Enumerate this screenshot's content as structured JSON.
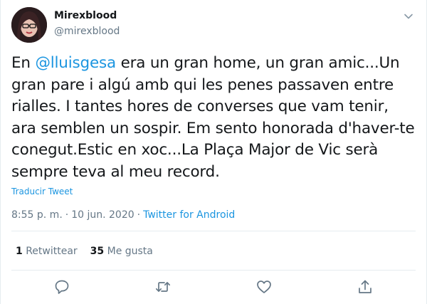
{
  "author": {
    "display_name": "Mirexblood",
    "handle": "@mirexblood"
  },
  "tweet": {
    "text_before_mention": "En ",
    "mention": "@lluisgesa",
    "text_after_mention": " era un gran home, un gran amic...Un gran pare i algú amb qui les penes passaven entre rialles. I tantes hores de converses que vam tenir, ara semblen un sospir. Em sento honorada d'haver-te conegut.Estic en xoc...La Plaça Major de Vic serà sempre teva al meu record."
  },
  "translate_label": "Traducir Tweet",
  "meta": {
    "time": "8:55 p. m.",
    "separator": "·",
    "date": "10 jun. 2020",
    "source": "Twitter for Android"
  },
  "stats": {
    "retweets_count": "1",
    "retweets_label": "Retwittear",
    "likes_count": "35",
    "likes_label": "Me gusta"
  },
  "icons": {
    "menu": "chevron-down-icon",
    "reply": "reply-icon",
    "retweet": "retweet-icon",
    "like": "heart-icon",
    "share": "share-icon"
  },
  "colors": {
    "link": "#1b95e0",
    "secondary_text": "#657786",
    "primary_text": "#14171a",
    "divider": "#e6ecf0"
  }
}
